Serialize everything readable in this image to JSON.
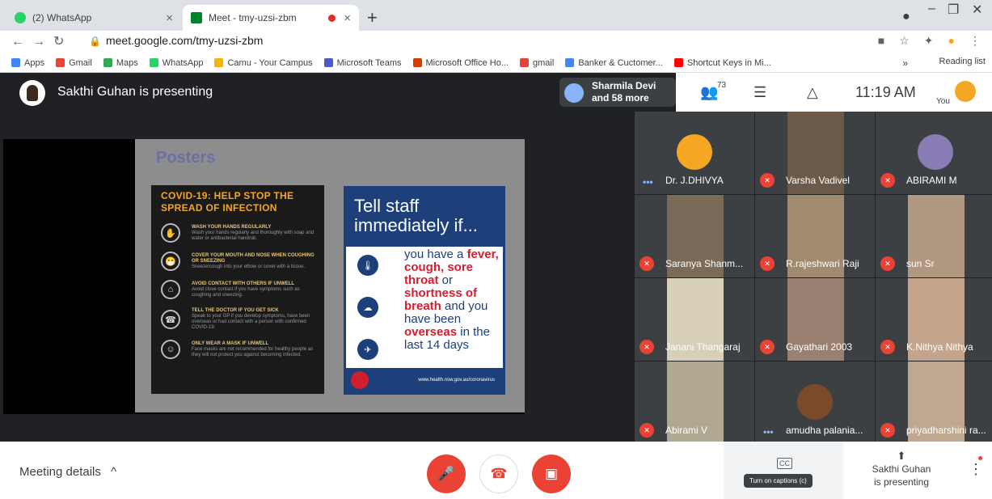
{
  "browser": {
    "tabs": [
      {
        "label": "(2) WhatsApp",
        "close": "×",
        "color": "#25d366"
      },
      {
        "label": "Meet - tmy-uzsi-zbm",
        "close": "×",
        "color": "#00832d"
      }
    ],
    "new_tab": "+",
    "url": "meet.google.com/tmy-uzsi-zbm",
    "bookmarks": [
      {
        "label": "Apps",
        "color": "#4285f4"
      },
      {
        "label": "Gmail",
        "color": "#ea4335"
      },
      {
        "label": "Maps",
        "color": "#34a853"
      },
      {
        "label": "WhatsApp",
        "color": "#25d366"
      },
      {
        "label": "Camu - Your Campus",
        "color": "#f4b400"
      },
      {
        "label": "Microsoft Teams",
        "color": "#5059c9"
      },
      {
        "label": "Microsoft Office Ho...",
        "color": "#d83b01"
      },
      {
        "label": "gmail",
        "color": "#ea4335"
      },
      {
        "label": "Banker & Cuctomer...",
        "color": "#4285f4"
      },
      {
        "label": "Shortcut Keys in Mi...",
        "color": "#ff0000"
      }
    ],
    "bookmarks_more": "»",
    "reading_list": "Reading list"
  },
  "meet": {
    "presenter_text": "Sakthi Guhan is presenting",
    "join_text_1": "Sharmila Devi",
    "join_text_2": "and 58 more",
    "participant_count": "73",
    "clock": "11:19 AM",
    "you_label": "You"
  },
  "slide": {
    "heading": "Posters",
    "poster1_title": "COVID-19: HELP STOP THE SPREAD OF INFECTION",
    "poster1_items": [
      {
        "head": "WASH YOUR HANDS REGULARLY",
        "sub": "Wash your hands regularly and thoroughly with soap and water or antibacterial handrub."
      },
      {
        "head": "COVER YOUR MOUTH AND NOSE WHEN COUGHING OR SNEEZING",
        "sub": "Sneeze/cough into your elbow or cover with a tissue."
      },
      {
        "head": "AVOID CONTACT WITH OTHERS IF UNWELL",
        "sub": "Avoid close contact if you have symptoms such as coughing and sneezing."
      },
      {
        "head": "TELL THE DOCTOR IF YOU GET SICK",
        "sub": "Speak to your GP if you develop symptoms, have been overseas or had contact with a person with confirmed COVID-19."
      },
      {
        "head": "ONLY WEAR A MASK IF UNWELL",
        "sub": "Face masks are not recommended for healthy people as they will not protect you against becoming infected."
      }
    ],
    "poster2_head": "Tell staff immediately if...",
    "poster2_l1": "you have a",
    "poster2_fever": "fever, cough, sore throat",
    "poster2_or": "or",
    "poster2_sob": "shortness of breath",
    "poster2_and": "and you have been",
    "poster2_overseas": "overseas",
    "poster2_tail": "in the last 14 days",
    "poster2_footer": "www.health.nsw.gov.au/coronavirus",
    "poster2_logo": "NSW"
  },
  "participants": [
    {
      "name": "Dr. J.DHIVYA",
      "muted": false,
      "color": "#f5a623"
    },
    {
      "name": "Varsha Vadivel",
      "muted": true,
      "color": "#6b5a4a"
    },
    {
      "name": "ABIRAMI M",
      "muted": true,
      "color": "#8a7cb5"
    },
    {
      "name": "Saranya Shanm...",
      "muted": true,
      "color": "#7a6a58"
    },
    {
      "name": "R.rajeshwari Raji",
      "muted": true,
      "color": "#a08a70"
    },
    {
      "name": "sun Sr",
      "muted": true,
      "color": "#b09880"
    },
    {
      "name": "Janani Thangaraj",
      "muted": true,
      "color": "#d8cfb8"
    },
    {
      "name": "Gayathari 2003",
      "muted": true,
      "color": "#9a8070"
    },
    {
      "name": "K.Nithya Nithya",
      "muted": true,
      "color": "#c4a48a"
    },
    {
      "name": "Abirami V",
      "muted": true,
      "color": "#b0a890"
    },
    {
      "name": "amudha palania...",
      "muted": false,
      "color": "#7a4a2a"
    },
    {
      "name": "priyadharshini ra...",
      "muted": true,
      "color": "#c0a890"
    }
  ],
  "bottom": {
    "meeting_details": "Meeting details",
    "caption_icon": "CC",
    "caption_tip": "Turn on captions (c)",
    "present_line1": "Sakthi Guhan",
    "present_line2": "is presenting"
  }
}
